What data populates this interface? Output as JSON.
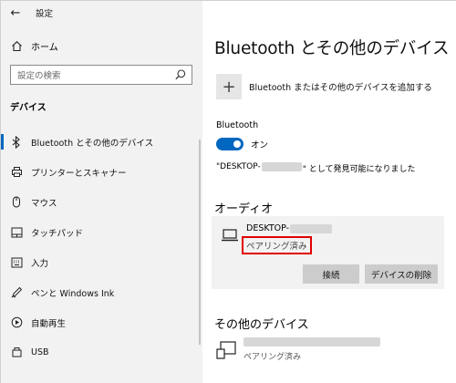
{
  "window": {
    "app_title": "設定",
    "minimize": "─",
    "maximize": "☐",
    "close": "✕",
    "back": "←"
  },
  "sidebar": {
    "home_label": "ホーム",
    "search_placeholder": "設定の検索",
    "section_title": "デバイス",
    "items": [
      {
        "label": "Bluetooth とその他のデバイス",
        "icon": "bluetooth-icon",
        "active": true
      },
      {
        "label": "プリンターとスキャナー",
        "icon": "printer-icon"
      },
      {
        "label": "マウス",
        "icon": "mouse-icon"
      },
      {
        "label": "タッチパッド",
        "icon": "touchpad-icon"
      },
      {
        "label": "入力",
        "icon": "keyboard-icon"
      },
      {
        "label": "ペンと Windows Ink",
        "icon": "pen-icon"
      },
      {
        "label": "自動再生",
        "icon": "autoplay-icon"
      },
      {
        "label": "USB",
        "icon": "usb-icon"
      }
    ]
  },
  "main": {
    "title": "Bluetooth とその他のデバイス",
    "add_device": "Bluetooth またはその他のデバイスを追加する",
    "bluetooth_label": "Bluetooth",
    "toggle_state": "オン",
    "discover_prefix": "\"DESKTOP-",
    "discover_suffix": "\" として発見可能になりました",
    "audio_section": "オーディオ",
    "audio_device": {
      "name": "DESKTOP-",
      "status": "ペアリング済み",
      "connect_button": "接続",
      "remove_button": "デバイスの削除"
    },
    "other_section": "その他のデバイス",
    "other_device": {
      "status": "ペアリング済み"
    }
  },
  "colors": {
    "accent": "#0067c0",
    "highlight_border": "#e00000",
    "sidebar_bg": "#f2f2f2",
    "button_bg": "#cccccc"
  }
}
